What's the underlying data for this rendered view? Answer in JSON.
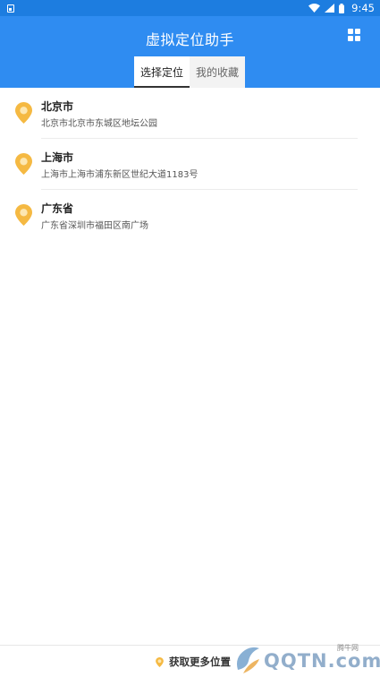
{
  "status_bar": {
    "time": "9:45"
  },
  "header": {
    "title": "虚拟定位助手"
  },
  "tabs": [
    {
      "label": "选择定位",
      "active": true
    },
    {
      "label": "我的收藏",
      "active": false
    }
  ],
  "locations": [
    {
      "name": "北京市",
      "address": "北京市北京市东城区地坛公园"
    },
    {
      "name": "上海市",
      "address": "上海市上海市浦东新区世纪大道1183号"
    },
    {
      "name": "广东省",
      "address": "广东省深圳市福田区南广场"
    }
  ],
  "bottom": {
    "more_label": "获取更多位置"
  },
  "watermark": {
    "text": "QQTN.com",
    "small": "腾牛网"
  },
  "colors": {
    "header": "#2f8cf1",
    "status_bar": "#1d7de0",
    "pin": "#f5b942"
  }
}
